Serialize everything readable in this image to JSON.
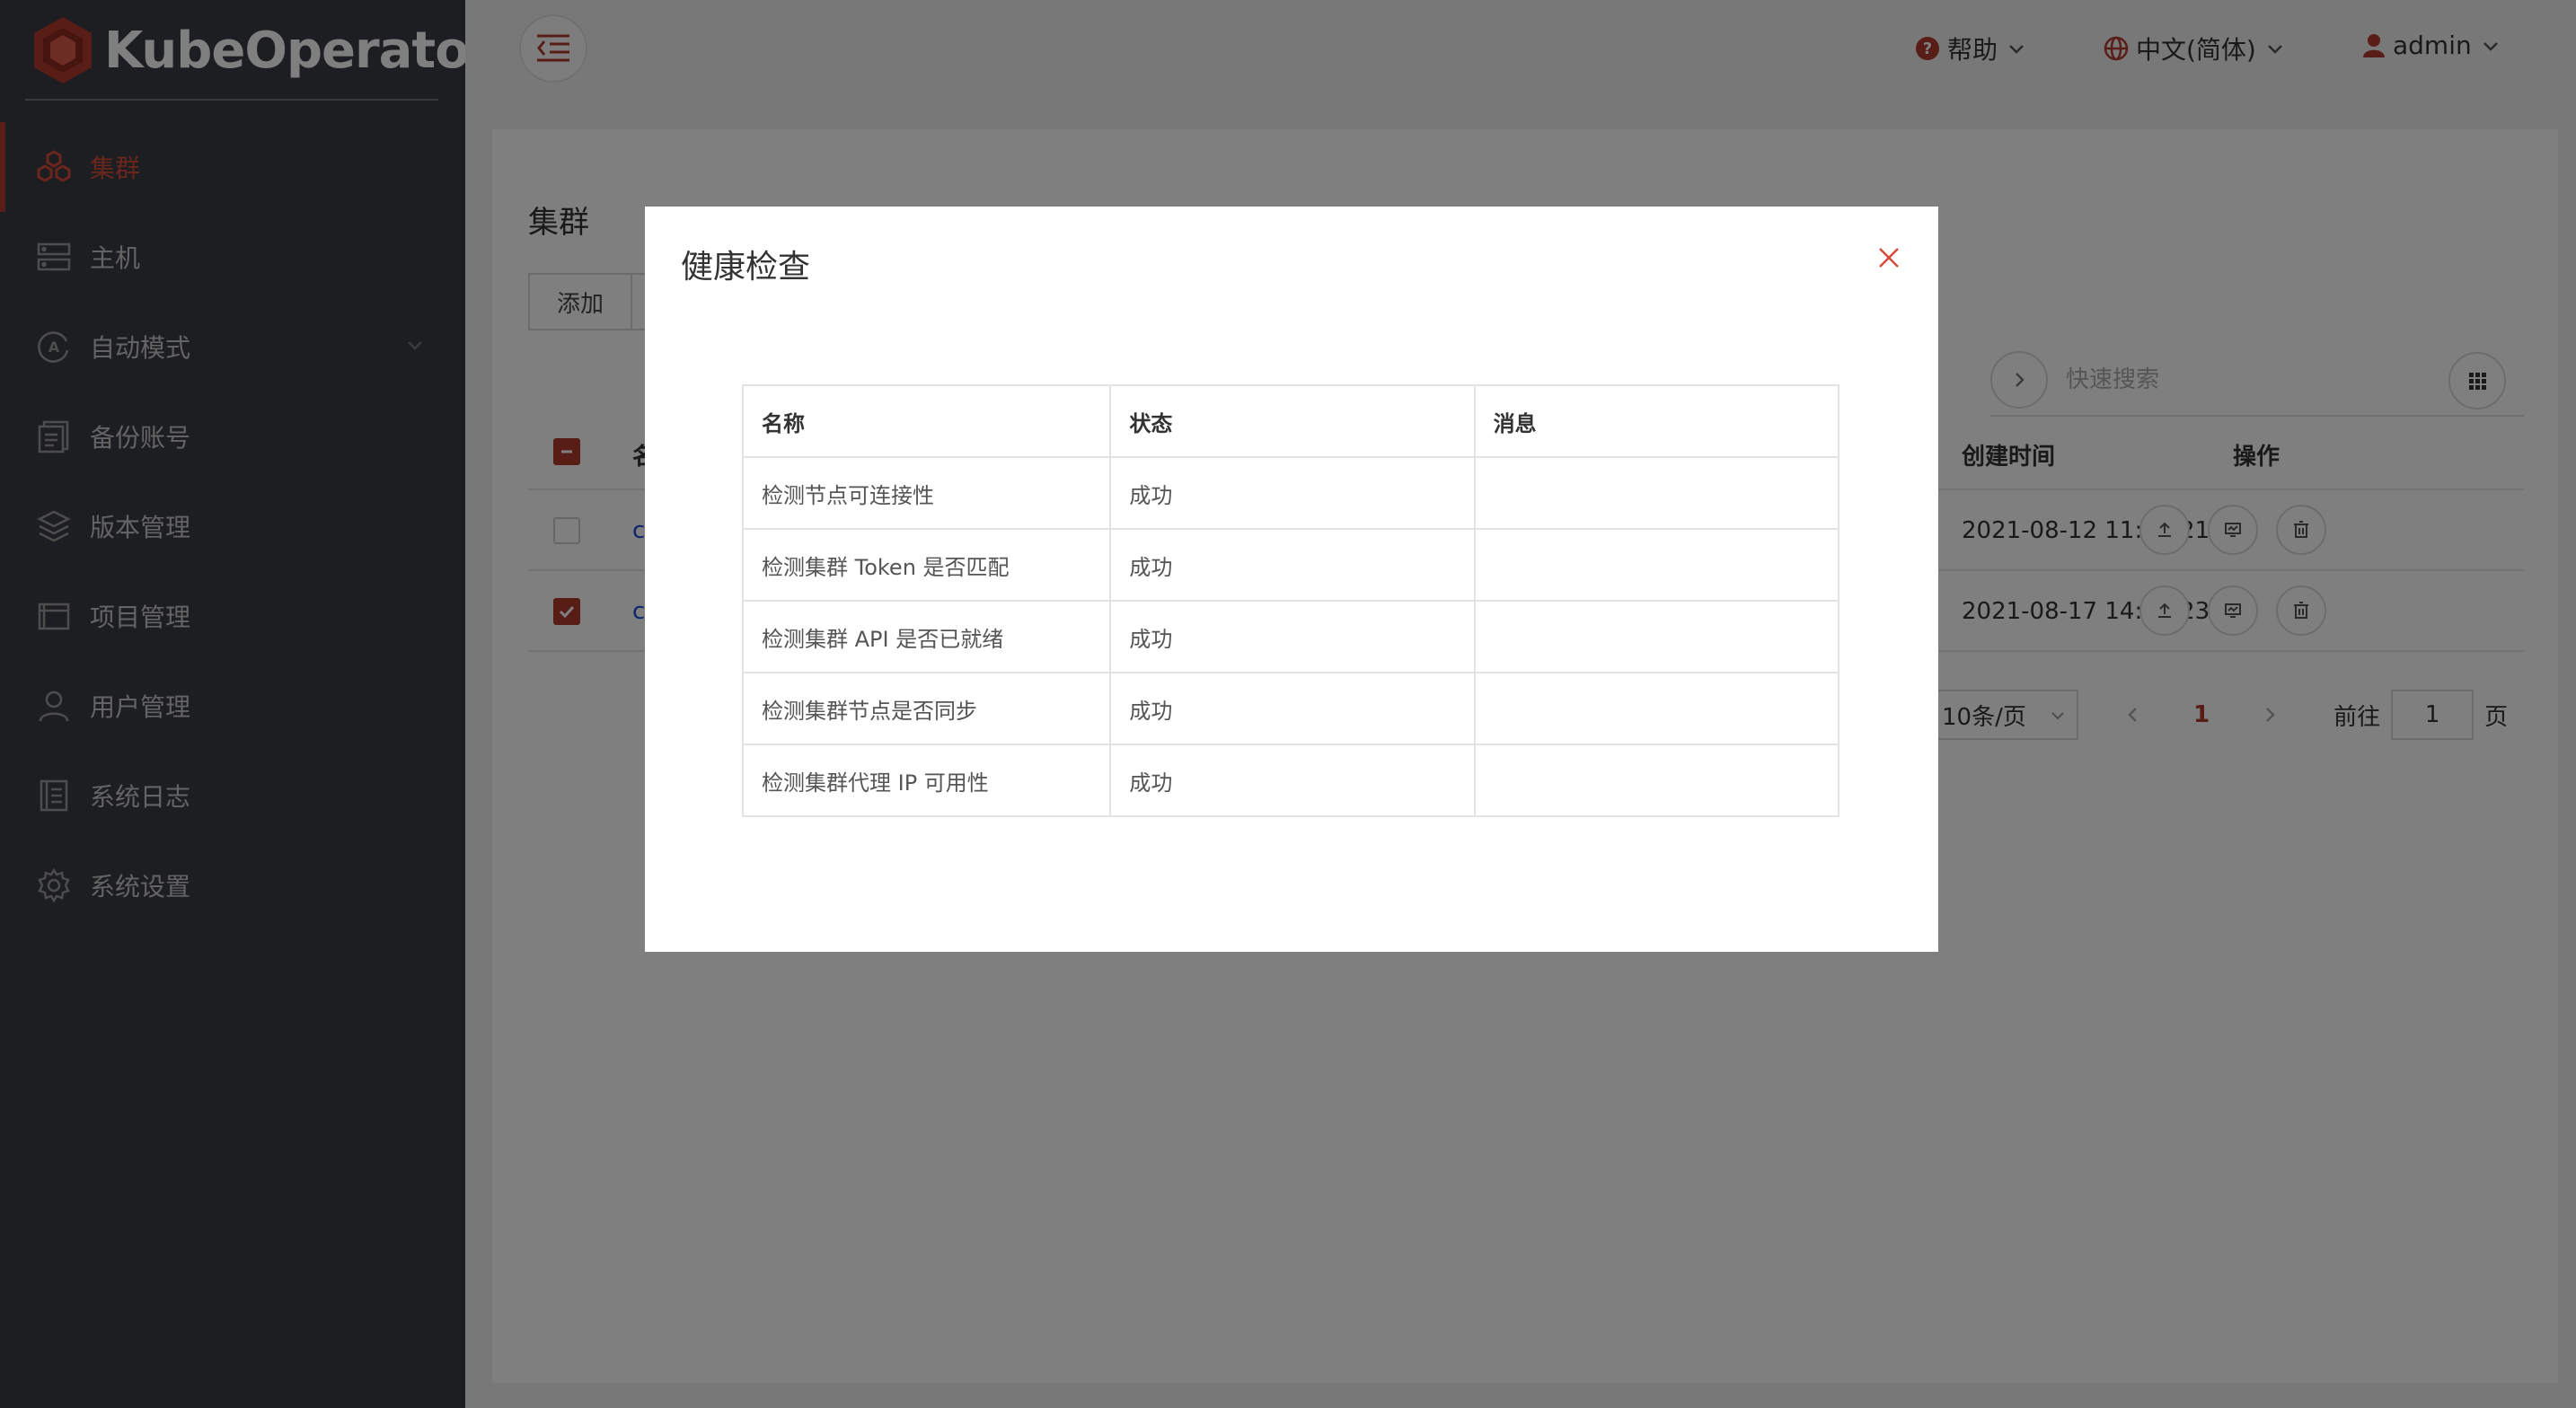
{
  "app": {
    "name": "KubeOperator"
  },
  "sidebar": {
    "items": [
      {
        "label": "集群",
        "icon": "cluster-icon",
        "active": true
      },
      {
        "label": "主机",
        "icon": "server-icon",
        "active": false
      },
      {
        "label": "自动模式",
        "icon": "auto-mode-icon",
        "active": false,
        "expandable": true
      },
      {
        "label": "备份账号",
        "icon": "backup-icon",
        "active": false
      },
      {
        "label": "版本管理",
        "icon": "layers-icon",
        "active": false
      },
      {
        "label": "项目管理",
        "icon": "folder-icon",
        "active": false
      },
      {
        "label": "用户管理",
        "icon": "user-icon",
        "active": false
      },
      {
        "label": "系统日志",
        "icon": "log-icon",
        "active": false
      },
      {
        "label": "系统设置",
        "icon": "gear-icon",
        "active": false
      }
    ]
  },
  "header": {
    "help": "帮助",
    "language": "中文(简体)",
    "user": "admin"
  },
  "page": {
    "title": "集群",
    "add_button": "添加",
    "search_placeholder": "快速搜索",
    "columns": {
      "first": "名",
      "created": "创建时间",
      "actions": "操作"
    },
    "rows": [
      {
        "name": "c",
        "created": "2021-08-12 11:03:21",
        "checked": false
      },
      {
        "name": "c",
        "created": "2021-08-17 14:12:23",
        "checked": true
      }
    ],
    "pagination": {
      "page_size": "10条/页",
      "current_page": "1",
      "goto_label": "前往",
      "goto_value": "1",
      "page_suffix": "页"
    }
  },
  "dialog": {
    "title": "健康检查",
    "columns": [
      "名称",
      "状态",
      "消息"
    ],
    "rows": [
      {
        "name": "检测节点可连接性",
        "status": "成功",
        "message": ""
      },
      {
        "name": "检测集群 Token 是否匹配",
        "status": "成功",
        "message": ""
      },
      {
        "name": "检测集群 API 是否已就绪",
        "status": "成功",
        "message": ""
      },
      {
        "name": "检测集群节点是否同步",
        "status": "成功",
        "message": ""
      },
      {
        "name": "检测集群代理 IP 可用性",
        "status": "成功",
        "message": ""
      }
    ]
  },
  "colors": {
    "accent": "#b23a2e",
    "sidebar_bg": "#3a3d42",
    "link": "#1e4bd8"
  }
}
